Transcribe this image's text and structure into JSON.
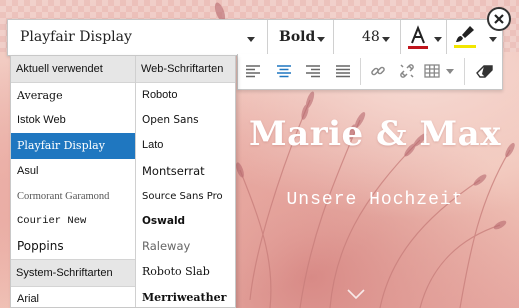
{
  "slide": {
    "title": "Marie & Max",
    "subtitle": "Unsere Hochzeit"
  },
  "toolbar": {
    "font_family": "Playfair Display",
    "font_weight": "Bold",
    "font_size": "48",
    "text_color": "#c0141c",
    "highlight_color": "#f2e600"
  },
  "toolbar2": {
    "buttons": [
      "align-left-icon",
      "align-center-icon",
      "align-right-icon",
      "align-justify-icon",
      "link-icon",
      "unlink-icon",
      "table-icon",
      "eraser-icon"
    ],
    "active": "align-center-icon"
  },
  "font_dropdown": {
    "recent_header": "Aktuell verwendet",
    "recent": [
      "Average",
      "Istok Web",
      "Playfair Display",
      "Asul",
      "Cormorant Garamond",
      "Courier New",
      "Poppins"
    ],
    "selected": "Playfair Display",
    "system_header": "System-Schriftarten",
    "system": [
      "Arial"
    ],
    "web_header": "Web-Schriftarten",
    "web": [
      "Roboto",
      "Open Sans",
      "Lato",
      "Montserrat",
      "Source Sans Pro",
      "Oswald",
      "Raleway",
      "Roboto Slab",
      "Merriweather"
    ]
  }
}
